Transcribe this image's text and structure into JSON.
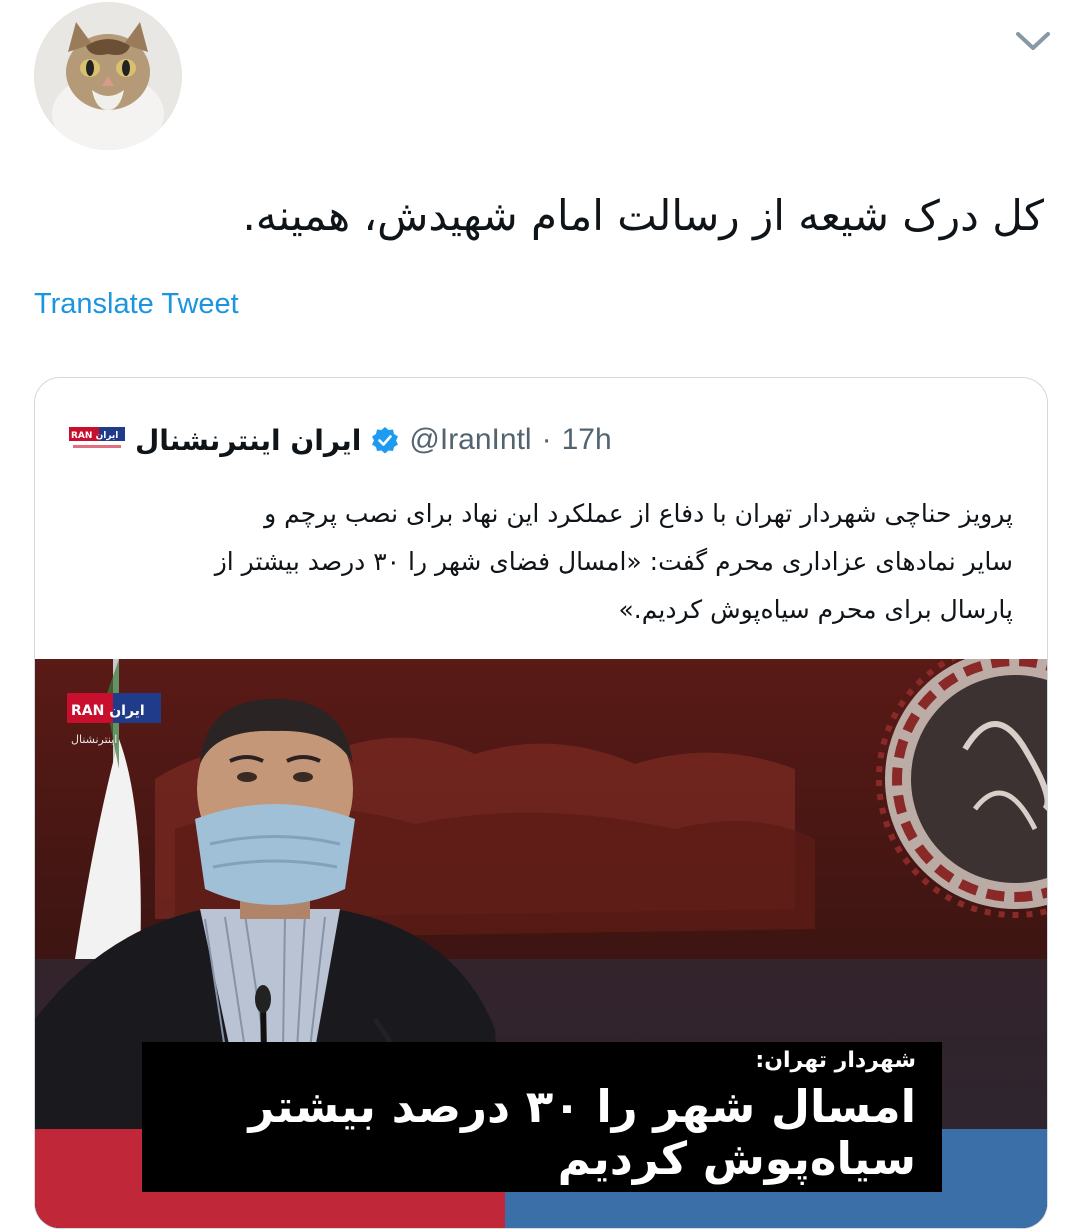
{
  "tweet": {
    "text": "کل درک شیعه از رسالت امام شهیدش، همینه.",
    "translate_label": "Translate Tweet"
  },
  "quoted": {
    "display_name": "ایران اینترنشنال",
    "handle": "@IranIntl",
    "separator": "·",
    "time": "17h",
    "logo_text": "RAN ایران",
    "body_lines": [
      "پرویز حناچی شهردار تهران با دفاع از عملکرد این نهاد برای نصب پرچم و",
      "سایر نمادهای عزاداری محرم گفت: «امسال فضای شهر را ۳۰ درصد بیشتر از",
      "پارسال برای محرم سیاه‌پوش کردیم.»"
    ],
    "image": {
      "channel_logo": "RAN ایران",
      "channel_logo_sub": "اینترنشنال",
      "caption_sub": "شهردار تهران:",
      "caption_line1": "امسال شهر را ۳۰ درصد بیشتر",
      "caption_line2": "سیاه‌پوش کردیم"
    }
  },
  "colors": {
    "link": "#1b95e0",
    "secondary_text": "#536471",
    "verified": "#1d9bf0",
    "brand_red": "#c8102e"
  },
  "icons": {
    "menu": "chevron-down-icon",
    "verified": "verified-badge-icon"
  }
}
